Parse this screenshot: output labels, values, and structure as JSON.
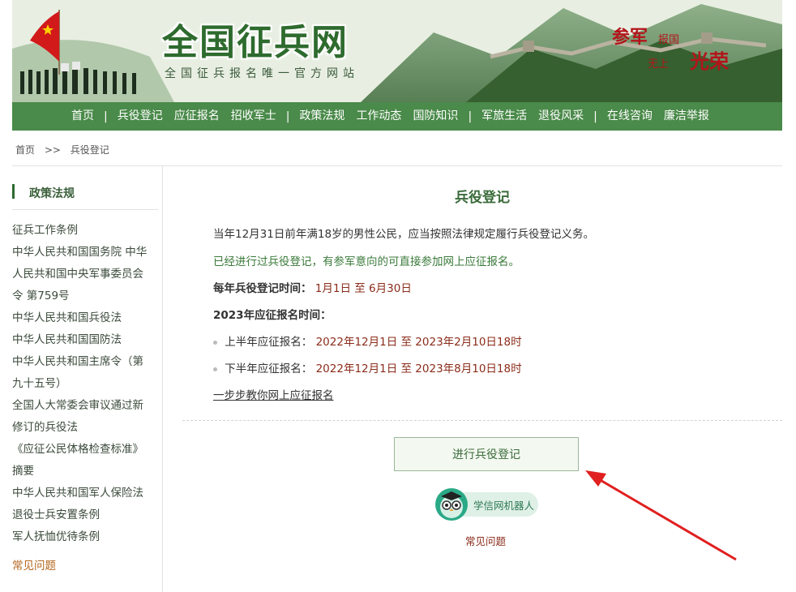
{
  "banner": {
    "title": "全国征兵网",
    "subtitle": "全国征兵报名唯一官方网站",
    "slogan": {
      "line1": "参军",
      "line2": "报国",
      "line3": "无上",
      "line4": "光荣"
    }
  },
  "nav": {
    "items": [
      "首页",
      "兵役登记",
      "应征报名",
      "招收军士",
      "政策法规",
      "工作动态",
      "国防知识",
      "军旅生活",
      "退役风采",
      "在线咨询",
      "廉洁举报"
    ],
    "separator": "|"
  },
  "breadcrumb": {
    "home": "首页",
    "sep": ">>",
    "current": "兵役登记"
  },
  "sidebar": {
    "heading": "政策法规",
    "items": [
      "征兵工作条例",
      "中华人民共和国国务院 中华",
      "人民共和国中央军事委员会",
      "令 第759号",
      "中华人民共和国兵役法",
      "中华人民共和国国防法",
      "中华人民共和国主席令（第",
      "九十五号）",
      "全国人大常委会审议通过新",
      "修订的兵役法",
      "《应征公民体格检查标准》",
      "摘要",
      "中华人民共和国军人保险法",
      "退役士兵安置条例",
      "军人抚恤优待条例"
    ],
    "faq": "常见问题"
  },
  "main": {
    "title": "兵役登记",
    "para1": "当年12月31日前年满18岁的男性公民，应当按照法律规定履行兵役登记义务。",
    "para2": "已经进行过兵役登记，有参军意向的可直接参加网上应征报名。",
    "period_label": "每年兵役登记时间：",
    "period_value": "1月1日 至 6月30日",
    "recruit_heading": "2023年应征报名时间：",
    "first_half_label": "上半年应征报名：",
    "first_half_value": "2022年12月1日 至 2023年2月10日18时",
    "second_half_label": "下半年应征报名：",
    "second_half_value": "2022年12月1日 至 2023年8月10日18时",
    "guide_link": "一步步教你网上应征报名",
    "register_button": "进行兵役登记",
    "robot_label": "学信网机器人",
    "faq_link": "常见问题"
  },
  "colors": {
    "nav_green": "#4a8a4a",
    "title_green": "#2e6b2e",
    "slogan_red": "#b3141a",
    "value_brown": "#8b2c1a",
    "arrow_red": "#e02020"
  }
}
